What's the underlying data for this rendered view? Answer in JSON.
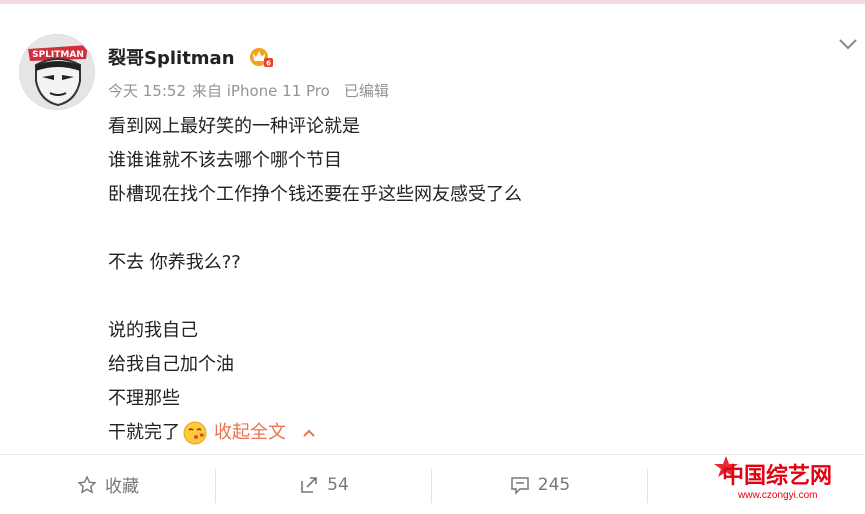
{
  "post": {
    "author": "裂哥Splitman",
    "timestamp": "今天 15:52",
    "source": "来自 iPhone 11 Pro",
    "edited": "已编辑",
    "lines": [
      "看到网上最好笑的一种评论就是",
      "谁谁谁就不该去哪个哪个节目",
      "卧槽现在找个工作挣个钱还要在乎这些网友感受了么",
      "",
      "不去 你养我么??",
      "",
      "说的我自己",
      "给我自己加个油",
      "不理那些"
    ],
    "last_line": "干就完了",
    "collapse_label": "收起全文"
  },
  "actions": {
    "favorite_label": "收藏",
    "repost_count": "54",
    "comment_count": "245"
  },
  "avatar_text": "SPLITMAN",
  "watermark": {
    "main": "中国综艺网",
    "url": "www.czongyi.com"
  },
  "colors": {
    "accent": "#eb7350",
    "watermark": "#e60012"
  }
}
